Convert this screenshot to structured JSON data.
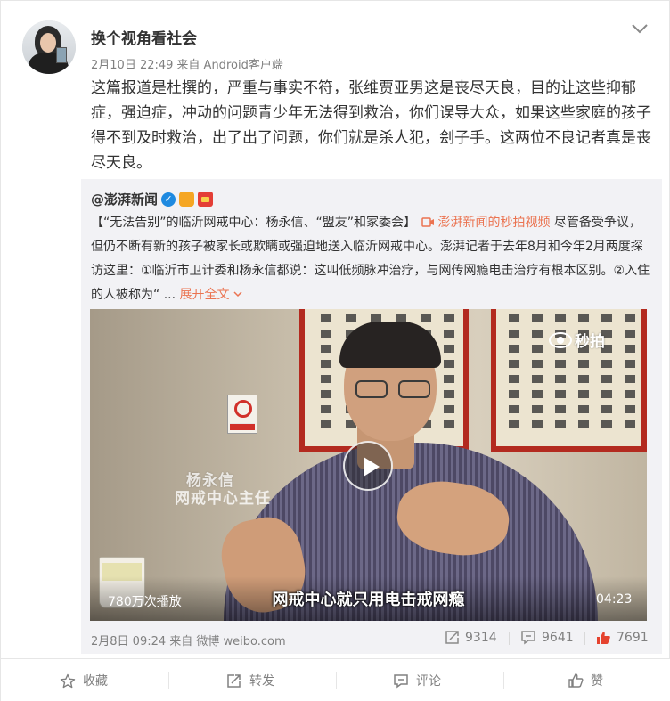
{
  "post": {
    "author": "换个视角看社会",
    "date": "2月10日 22:49",
    "source": "来自 Android客户端",
    "text": "这篇报道是杜撰的，严重与事实不符，张维贾亚男这是丧尽天良，目的让这些抑郁症，强迫症，冲动的问题青少年无法得到救治，你们误导大众，如果这些家庭的孩子得不到及时救治，出了出了问题，你们就是杀人犯，刽子手。这两位不良记者真是丧尽天良。"
  },
  "repost": {
    "author": "@澎湃新闻",
    "text_title": "【“无法告别”的临沂网戒中心：杨永信、“盟友”和家委会】",
    "video_link": "澎湃新闻的秒拍视频",
    "text_body": "尽管备受争议，但仍不断有新的孩子被家长或欺瞒或强迫地送入临沂网戒中心。澎湃记者于去年8月和今年2月两度探访这里：①临沂市卫计委和杨永信都说：这叫低频脉冲治疗，与网传网瘾电击治疗有根本区别。②入住的人被称为“ ...",
    "expand": "展开全文",
    "video": {
      "watermark": "秒拍",
      "caption_name": "杨永信",
      "caption_title": "网戒中心主任",
      "subtitle": "网戒中心就只用电击戒网瘾",
      "plays": "780万次播放",
      "duration": "04:23"
    },
    "time": "2月8日 09:24",
    "source": "来自 微博 weibo.com",
    "reposts": "9314",
    "comments": "9641",
    "likes": "7691"
  },
  "actions": {
    "favorite": "收藏",
    "forward": "转发",
    "comment": "评论",
    "like": "赞"
  },
  "colors": {
    "link": "#eb7350",
    "like_red": "#e5432f",
    "verified_blue": "#1f8ae0",
    "frame_red": "#b32a1f"
  }
}
